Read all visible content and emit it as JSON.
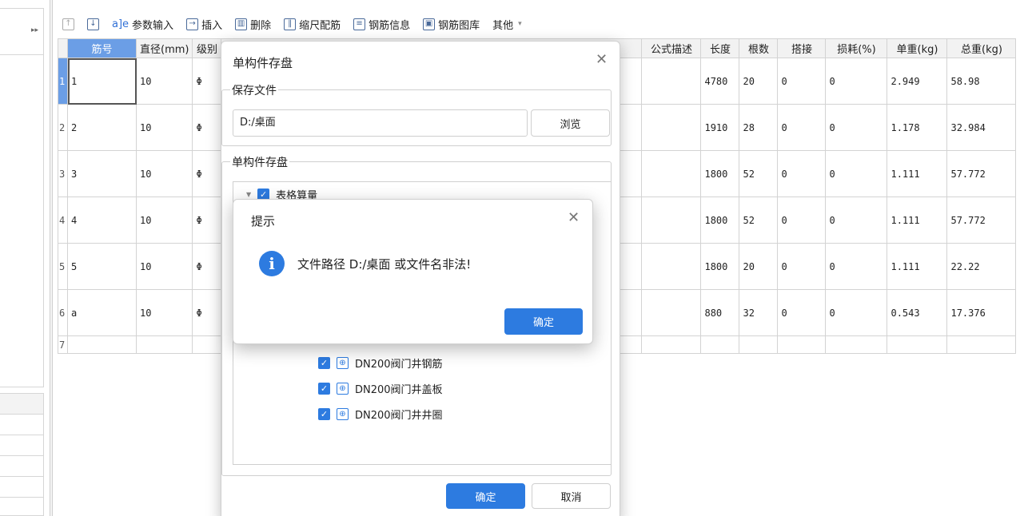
{
  "toolbar": {
    "items": [
      {
        "label": "",
        "icon": "arrow-up-icon"
      },
      {
        "label": "",
        "icon": "arrow-down-icon"
      },
      {
        "label": "参数输入",
        "icon": "param-input-icon"
      },
      {
        "label": "插入",
        "icon": "insert-icon"
      },
      {
        "label": "删除",
        "icon": "delete-icon"
      },
      {
        "label": "缩尺配筋",
        "icon": "scale-rebar-icon"
      },
      {
        "label": "钢筋信息",
        "icon": "rebar-info-icon"
      },
      {
        "label": "钢筋图库",
        "icon": "rebar-library-icon"
      },
      {
        "label": "其他",
        "icon": ""
      }
    ]
  },
  "table": {
    "headers": {
      "bar_no": "筋号",
      "diameter": "直径(mm)",
      "grade": "级别",
      "formula_desc": "公式描述",
      "length": "长度",
      "count": "根数",
      "lap": "搭接",
      "loss": "损耗(%)",
      "unit_weight": "单重(kg)",
      "total_weight": "总重(kg)"
    },
    "rows": [
      {
        "idx": "1",
        "bar_no": "1",
        "diameter": "10",
        "grade": "Φ",
        "length": "4780",
        "count": "20",
        "lap": "0",
        "loss": "0",
        "unit_weight": "2.949",
        "total_weight": "58.98"
      },
      {
        "idx": "2",
        "bar_no": "2",
        "diameter": "10",
        "grade": "Φ",
        "length": "1910",
        "count": "28",
        "lap": "0",
        "loss": "0",
        "unit_weight": "1.178",
        "total_weight": "32.984"
      },
      {
        "idx": "3",
        "bar_no": "3",
        "diameter": "10",
        "grade": "Φ",
        "length": "1800",
        "count": "52",
        "lap": "0",
        "loss": "0",
        "unit_weight": "1.111",
        "total_weight": "57.772"
      },
      {
        "idx": "4",
        "bar_no": "4",
        "diameter": "10",
        "grade": "Φ",
        "length": "1800",
        "count": "52",
        "lap": "0",
        "loss": "0",
        "unit_weight": "1.111",
        "total_weight": "57.772"
      },
      {
        "idx": "5",
        "bar_no": "5",
        "diameter": "10",
        "grade": "Φ",
        "length": "1800",
        "count": "20",
        "lap": "0",
        "loss": "0",
        "unit_weight": "1.111",
        "total_weight": "22.22"
      },
      {
        "idx": "6",
        "bar_no": "a",
        "diameter": "10",
        "grade": "Φ",
        "length": "880",
        "count": "32",
        "lap": "0",
        "loss": "0",
        "unit_weight": "0.543",
        "total_weight": "17.376"
      },
      {
        "idx": "7",
        "bar_no": "",
        "diameter": "",
        "grade": "",
        "length": "",
        "count": "",
        "lap": "",
        "loss": "",
        "unit_weight": "",
        "total_weight": ""
      }
    ]
  },
  "save_dialog": {
    "title": "单构件存盘",
    "save_file_legend": "保存文件",
    "path_value": "D:/桌面",
    "browse_label": "浏览",
    "section_legend": "单构件存盘",
    "tree_root": "表格算量",
    "tree_items": [
      "DN200阀门井钢筋",
      "DN200阀门井盖板",
      "DN200阀门井井圈"
    ],
    "ok_label": "确定",
    "cancel_label": "取消"
  },
  "alert": {
    "title": "提示",
    "message": "文件路径 D:/桌面 或文件名非法!",
    "ok_label": "确定"
  },
  "colors": {
    "accent": "#2d7be0",
    "header_active": "#6b9ee6"
  }
}
